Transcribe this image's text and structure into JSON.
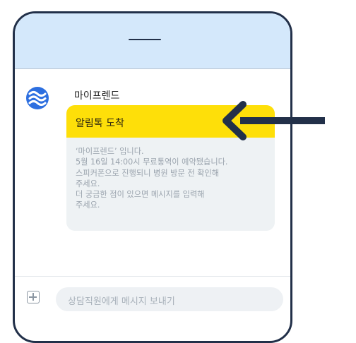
{
  "chat": {
    "sender_name": "마이프렌드",
    "message": {
      "title": "알림톡 도착",
      "body_lines": [
        "‘마이프렌드’ 입니다.",
        "5월 16일 14:00시 무료통역이 예약됐습니다.",
        "스피커폰으로 진행되니 병원 방문 전 확인해",
        "주세요.",
        "더 궁금한 점이 있으면 메시지를 입력해",
        "주세요."
      ]
    }
  },
  "composer": {
    "placeholder": "상담직원에게 메시지 보내기"
  },
  "colors": {
    "header_bg": "#d4e8fb",
    "highlight": "#fedf09",
    "frame": "#223049",
    "bubble_bg": "#eef2f4",
    "avatar": "#2d6fe0"
  }
}
